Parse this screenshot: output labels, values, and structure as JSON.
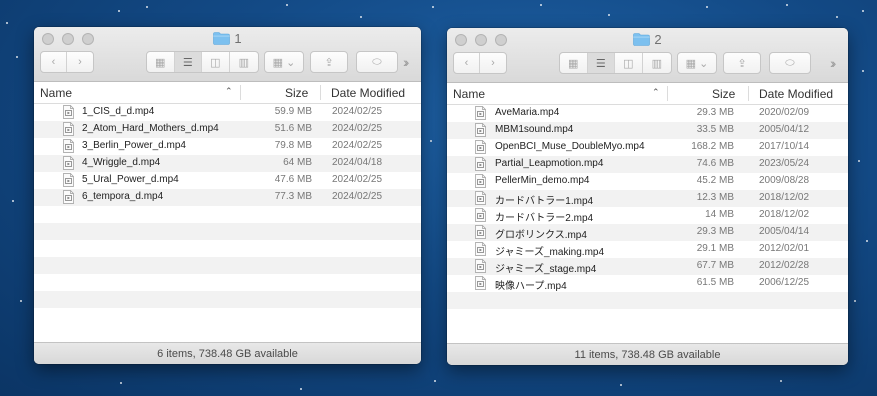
{
  "windows": [
    {
      "title": "1",
      "columns": {
        "name": "Name",
        "size": "Size",
        "date": "Date Modified"
      },
      "files": [
        {
          "name": "1_CIS_d_d.mp4",
          "size": "59.9 MB",
          "date": "2024/02/25"
        },
        {
          "name": "2_Atom_Hard_Mothers_d.mp4",
          "size": "51.6 MB",
          "date": "2024/02/25"
        },
        {
          "name": "3_Berlin_Power_d.mp4",
          "size": "79.8 MB",
          "date": "2024/02/25"
        },
        {
          "name": "4_Wriggle_d.mp4",
          "size": "64 MB",
          "date": "2024/04/18"
        },
        {
          "name": "5_Ural_Power_d.mp4",
          "size": "47.6 MB",
          "date": "2024/02/25"
        },
        {
          "name": "6_tempora_d.mp4",
          "size": "77.3 MB",
          "date": "2024/02/25"
        }
      ],
      "status": "6 items, 738.48 GB available"
    },
    {
      "title": "2",
      "columns": {
        "name": "Name",
        "size": "Size",
        "date": "Date Modified"
      },
      "files": [
        {
          "name": "AveMaria.mp4",
          "size": "29.3 MB",
          "date": "2020/02/09"
        },
        {
          "name": "MBM1sound.mp4",
          "size": "33.5 MB",
          "date": "2005/04/12"
        },
        {
          "name": "OpenBCI_Muse_DoubleMyo.mp4",
          "size": "168.2 MB",
          "date": "2017/10/14"
        },
        {
          "name": "Partial_Leapmotion.mp4",
          "size": "74.6 MB",
          "date": "2023/05/24"
        },
        {
          "name": "PellerMin_demo.mp4",
          "size": "45.2 MB",
          "date": "2009/08/28"
        },
        {
          "name": "カードバトラー1.mp4",
          "size": "12.3 MB",
          "date": "2018/12/02"
        },
        {
          "name": "カードバトラー2.mp4",
          "size": "14 MB",
          "date": "2018/12/02"
        },
        {
          "name": "グロボリンクス.mp4",
          "size": "29.3 MB",
          "date": "2005/04/14"
        },
        {
          "name": "ジャミーズ_making.mp4",
          "size": "29.1 MB",
          "date": "2012/02/01"
        },
        {
          "name": "ジャミーズ_stage.mp4",
          "size": "67.7 MB",
          "date": "2012/02/28"
        },
        {
          "name": "映像ハープ.mp4",
          "size": "61.5 MB",
          "date": "2006/12/25"
        }
      ],
      "status": "11 items, 738.48 GB available"
    }
  ],
  "toolbar_icons": [
    "back-icon",
    "forward-icon",
    "icon-view-icon",
    "list-view-icon",
    "column-view-icon",
    "gallery-view-icon",
    "arrange-icon",
    "share-icon",
    "tag-icon",
    "more-icon"
  ],
  "colors": {
    "folder": "#7cc0ef",
    "desktop": "#134a86",
    "stripe": "#f2f2f2"
  }
}
